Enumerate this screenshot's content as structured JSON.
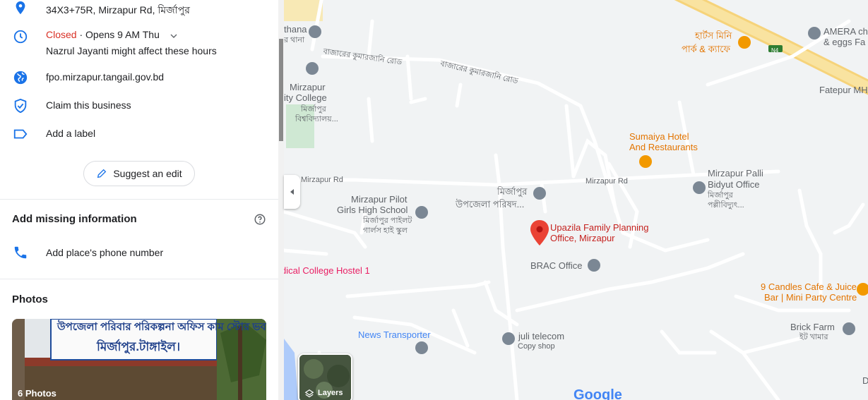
{
  "panel": {
    "address": "34X3+75R, Mirzapur Rd, মির্জাপুর",
    "hours": {
      "status": "Closed",
      "separator": " · ",
      "opens": "Opens 9 AM Thu",
      "holiday_note": "Nazrul Jayanti might affect these hours"
    },
    "website": "fpo.mirzapur.tangail.gov.bd",
    "claim": "Claim this business",
    "label": "Add a label",
    "suggest_edit": "Suggest an edit",
    "missing_title": "Add missing information",
    "add_phone": "Add place's phone number",
    "photos_title": "Photos",
    "photos_count": "6 Photos",
    "photo_sign_line1": "উপজেলা পরিবার পরিকল্পনা অফিস কাম স্টোর ভবন",
    "photo_sign_line2": "মির্জাপুর.টাঙ্গাইল।"
  },
  "map": {
    "layers_label": "Layers",
    "google": "Google",
    "labels": {
      "thana": "thana",
      "thana_bn": "র থানা",
      "mirzapur_college": "Mirzapur",
      "city_college": "ity College",
      "mirzapur_bn": "মির্জাপুর",
      "university_bn": "বিশ্ববিদ্যালয়...",
      "road_bn1": "বাজারের কুমারজানি রোড",
      "road_bn2": "বাজারের কুমারজানি রোড",
      "mirzapur_rd_left": "Mirzapur Rd",
      "mirzapur_rd_right": "Mirzapur Rd",
      "cafe_bn1": "হার্টস মিনি",
      "cafe_bn2": "পার্ক & ক্যাফে",
      "n4": "N4",
      "amera1": "AMERA ch",
      "amera2": "& eggs Fa",
      "fatepur": "Fatepur MH",
      "sumaiya1": "Sumaiya Hotel",
      "sumaiya2": "And Restaurants",
      "palli1": "Mirzapur Palli",
      "palli2": "Bidyut Office",
      "palli_bn1": "মির্জাপুর",
      "palli_bn2": "পল্লীবিদ্যুৎ...",
      "upazila_bn1": "মির্জাপুর",
      "upazila_bn2": "উপজেলা পরিষদ...",
      "pilot1": "Mirzapur Pilot",
      "pilot2": "Girls High School",
      "pilot_bn1": "মির্জাপুর পাইলট",
      "pilot_bn2": "গার্লস হাই স্কুল",
      "selected1": "Upazila Family Planning",
      "selected2": "Office, Mirzapur",
      "brac": "BRAC Office",
      "hostel": "dical College Hostel 1",
      "candles1": "9 Candles Cafe & Juice",
      "candles2": "Bar | Mini Party Centre",
      "brick": "Brick Farm",
      "brick_bn": "ইট খামার",
      "news": "News Transporter",
      "juli": "juli telecom",
      "copy": "Copy shop",
      "d": "D"
    }
  }
}
